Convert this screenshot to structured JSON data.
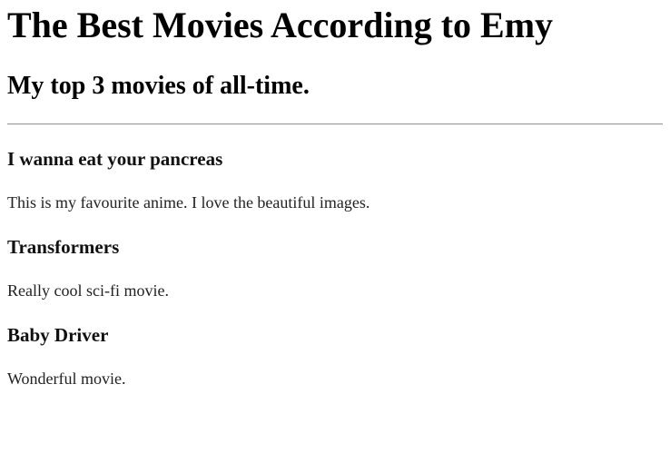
{
  "page": {
    "title": "The Best Movies According to Emy",
    "subtitle": "My top 3 movies of all-time."
  },
  "movies": [
    {
      "title": "I wanna eat your pancreas",
      "description": "This is my favourite anime. I love the beautiful images."
    },
    {
      "title": "Transformers",
      "description": "Really cool sci-fi movie."
    },
    {
      "title": "Baby Driver",
      "description": "Wonderful movie."
    }
  ]
}
